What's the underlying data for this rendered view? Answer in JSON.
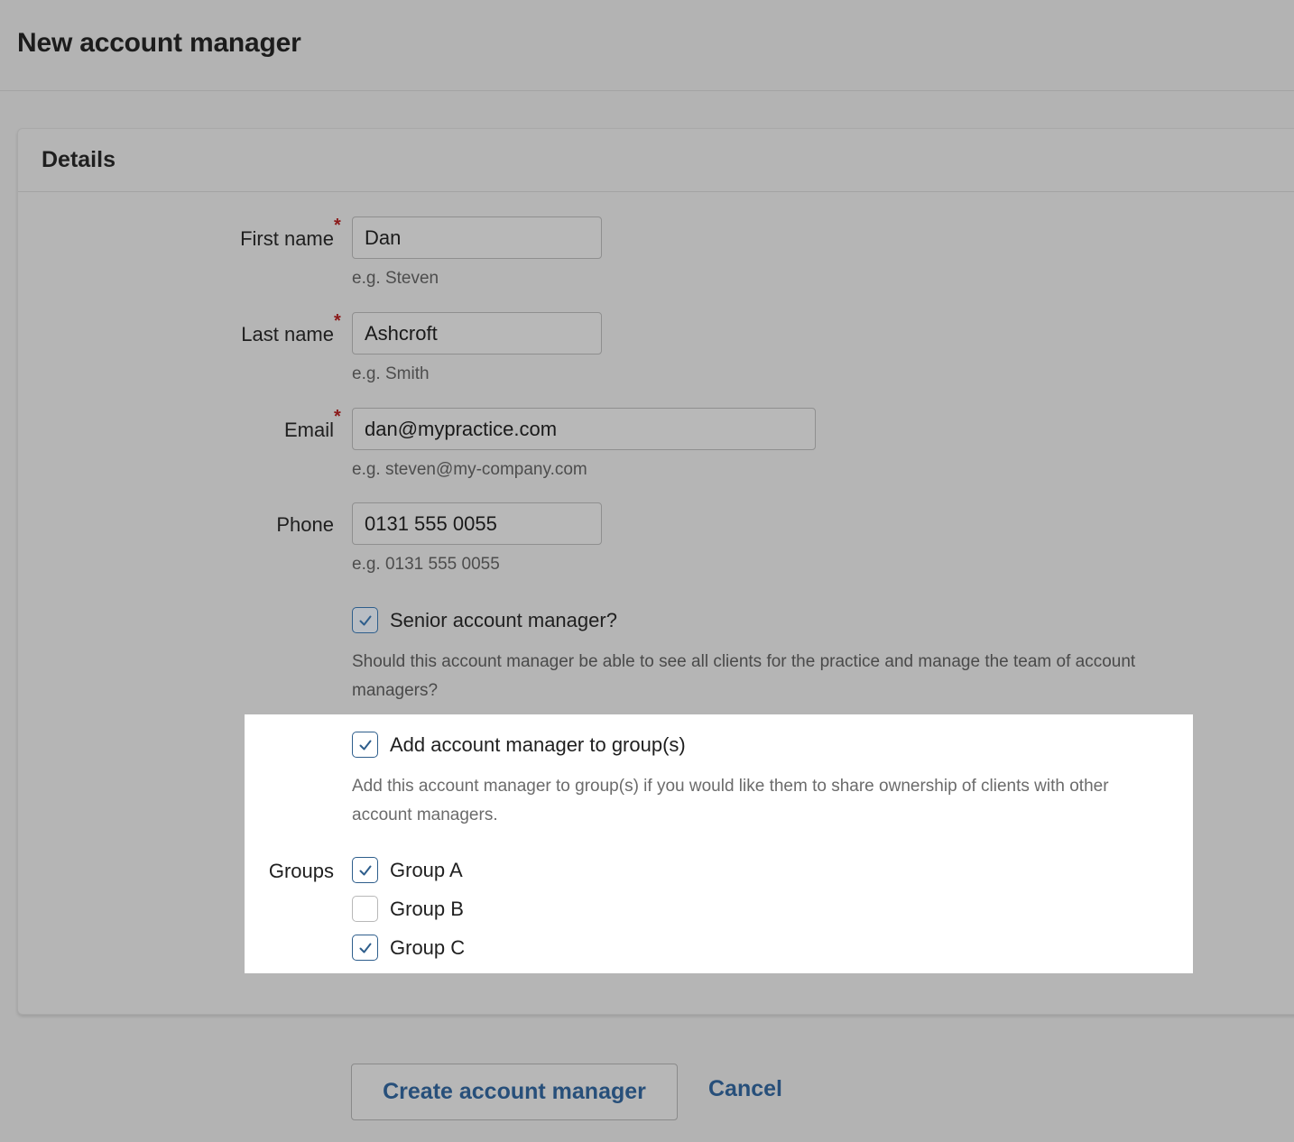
{
  "page": {
    "title": "New account manager"
  },
  "details": {
    "title": "Details",
    "fields": {
      "first_name": {
        "label": "First name",
        "required": "*",
        "value": "Dan",
        "hint": "e.g. Steven"
      },
      "last_name": {
        "label": "Last name",
        "required": "*",
        "value": "Ashcroft",
        "hint": "e.g. Smith"
      },
      "email": {
        "label": "Email",
        "required": "*",
        "value": "dan@mypractice.com",
        "hint": "e.g. steven@my-company.com"
      },
      "phone": {
        "label": "Phone",
        "value": "0131 555 0055",
        "hint": "e.g. 0131 555 0055"
      }
    },
    "senior": {
      "label": "Senior account manager?",
      "checked": true,
      "help_line1": "Should this account manager be able to see all clients for the practice and manage the team of account",
      "help_line2": "managers?"
    },
    "add_to_group": {
      "label": "Add account manager to group(s)",
      "checked": true,
      "help_line1": "Add this account manager to group(s) if you would like them to share ownership of clients with other",
      "help_line2": "account managers."
    },
    "groups": {
      "label": "Groups",
      "items": [
        {
          "label": "Group A",
          "checked": true
        },
        {
          "label": "Group B",
          "checked": false
        },
        {
          "label": "Group C",
          "checked": true
        }
      ]
    }
  },
  "actions": {
    "create_label": "Create account manager",
    "cancel_label": "Cancel"
  },
  "colors": {
    "accent": "#274f7a",
    "required": "#8b1a1a",
    "checkbox_border": "#2e5e8c"
  }
}
